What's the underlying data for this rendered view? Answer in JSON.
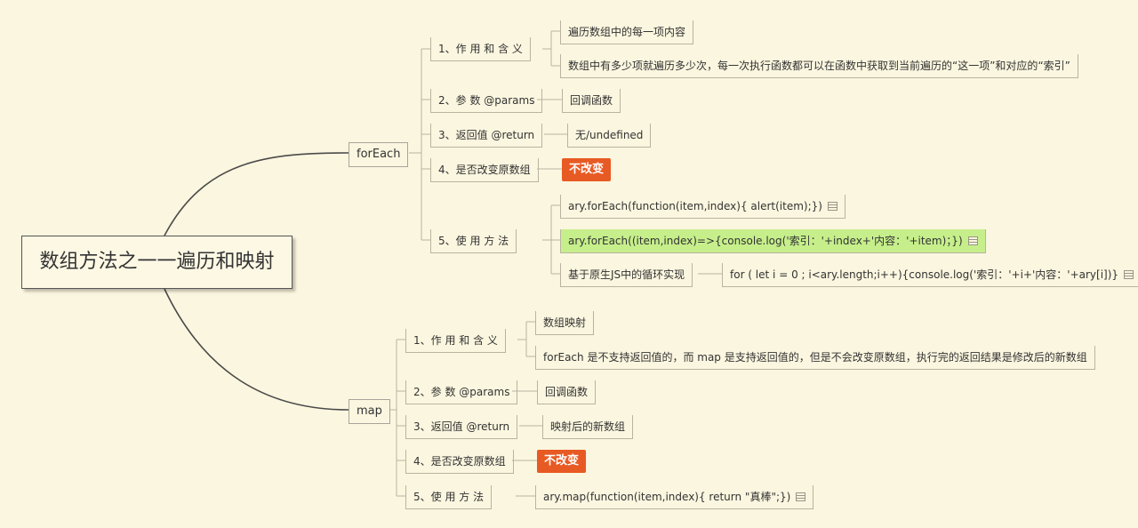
{
  "root": {
    "title": "数组方法之一一遍历和映射"
  },
  "foreach": {
    "label": "forEach",
    "items": [
      {
        "label": "1、作 用  和  含 义",
        "details": [
          "遍历数组中的每一项内容",
          "数组中有多少项就遍历多少次，每一次执行函数都可以在函数中获取到当前遍历的“这一项”和对应的“索引”"
        ]
      },
      {
        "label": "2、参 数 @params",
        "details": [
          "回调函数"
        ]
      },
      {
        "label": "3、返回值 @return",
        "details": [
          "无/undefined"
        ]
      },
      {
        "label": "4、是否改变原数组",
        "badge": "不改变"
      },
      {
        "label": "5、使  用  方  法",
        "details": [
          "ary.forEach(function(item,index){ alert(item);})",
          "ary.forEach((item,index)=>{console.log('索引：'+index+'内容：'+item)；})",
          "基于原生JS中的循环实现"
        ],
        "loop": "for ( let i = 0 ; i<ary.length;i++){console.log('索引：'+i+'内容：'+ary[i])}"
      }
    ]
  },
  "map": {
    "label": "map",
    "items": [
      {
        "label": "1、作 用  和  含 义",
        "details": [
          "数组映射",
          "forEach 是不支持返回值的，而 map 是支持返回值的，但是不会改变原数组，执行完的返回结果是修改后的新数组"
        ]
      },
      {
        "label": "2、参 数 @params",
        "details": [
          "回调函数"
        ]
      },
      {
        "label": "3、返回值 @return",
        "details": [
          "映射后的新数组"
        ]
      },
      {
        "label": "4、是否改变原数组",
        "badge": "不改变"
      },
      {
        "label": "5、使  用  方  法",
        "details": [
          "ary.map(function(item,index){ return \"真棒\";})"
        ]
      }
    ]
  },
  "colors": {
    "background": "#fbf6df",
    "badge": "#e85a24",
    "highlight": "#c6ef8b",
    "line": "#4a4a4a"
  },
  "icons": {
    "note": "note-icon"
  }
}
